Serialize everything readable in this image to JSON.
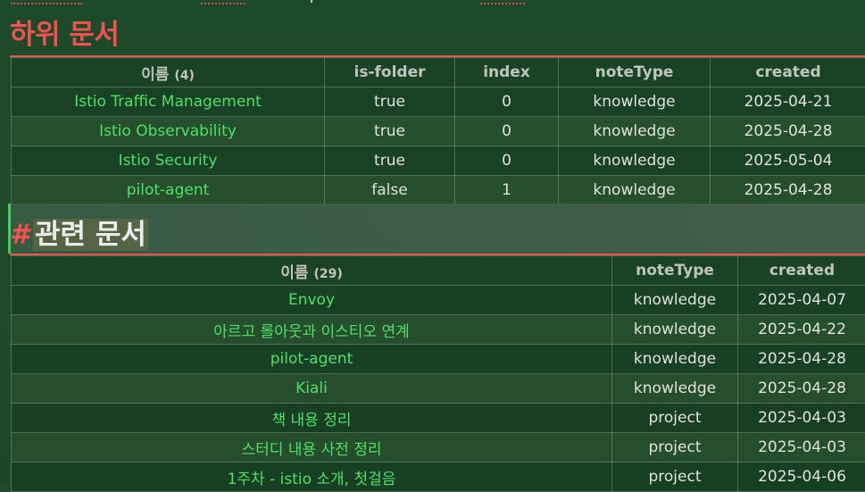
{
  "section1": {
    "title": "하위 문서",
    "table": {
      "headers": {
        "name": "이름",
        "count": "(4)",
        "is_folder": "is-folder",
        "index": "index",
        "note_type": "noteType",
        "created": "created"
      },
      "rows": [
        {
          "name": "Istio Traffic Management",
          "is_folder": "true",
          "index": "0",
          "note_type": "knowledge",
          "created": "2025-04-21"
        },
        {
          "name": "Istio Observability",
          "is_folder": "true",
          "index": "0",
          "note_type": "knowledge",
          "created": "2025-04-28"
        },
        {
          "name": "Istio Security",
          "is_folder": "true",
          "index": "0",
          "note_type": "knowledge",
          "created": "2025-05-04"
        },
        {
          "name": "pilot-agent",
          "is_folder": "false",
          "index": "1",
          "note_type": "knowledge",
          "created": "2025-04-28"
        }
      ]
    }
  },
  "section2": {
    "hash": "#",
    "title": "관련 문서",
    "table": {
      "headers": {
        "name": "이름",
        "count": "(29)",
        "note_type": "noteType",
        "created": "created"
      },
      "rows": [
        {
          "name": "Envoy",
          "note_type": "knowledge",
          "created": "2025-04-07"
        },
        {
          "name": "아르고 롤아웃과 이스티오 연계",
          "note_type": "knowledge",
          "created": "2025-04-22"
        },
        {
          "name": "pilot-agent",
          "note_type": "knowledge",
          "created": "2025-04-28"
        },
        {
          "name": "Kiali",
          "note_type": "knowledge",
          "created": "2025-04-28"
        },
        {
          "name": "책 내용 정리",
          "note_type": "project",
          "created": "2025-04-03"
        },
        {
          "name": "스터디 내용 사전 정리",
          "note_type": "project",
          "created": "2025-04-03"
        },
        {
          "name": "1주차 - istio 소개, 첫걸음",
          "note_type": "project",
          "created": "2025-04-06"
        }
      ]
    }
  },
  "colors": {
    "heading": "#f0504f",
    "link": "#4fe06a",
    "accent_bar": "#3bd35b"
  }
}
